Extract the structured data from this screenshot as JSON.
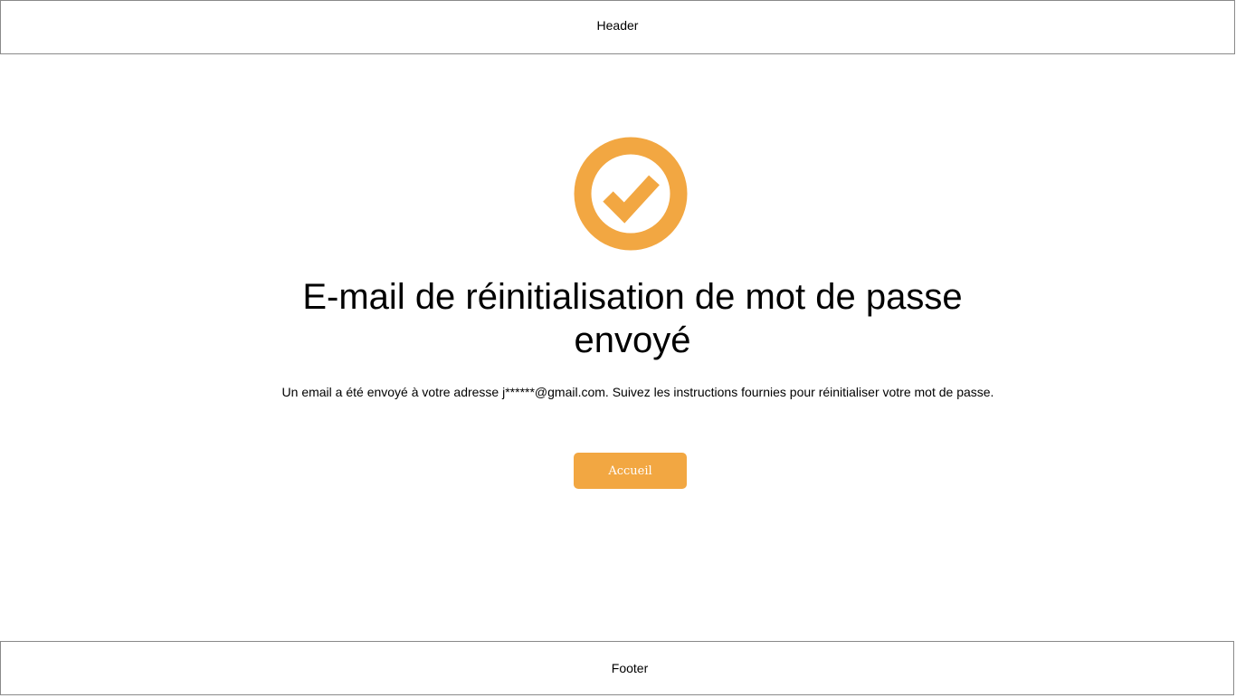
{
  "header": {
    "label": "Header"
  },
  "main": {
    "icon": "check-circle-icon",
    "accent_color": "#f2a742",
    "title": "E-mail de réinitialisation de mot de passe envoyé",
    "message": "Un email a été envoyé à votre adresse j******@gmail.com. Suivez les instructions fournies pour réinitialiser votre mot de passe.",
    "button_label": "Accueil"
  },
  "footer": {
    "label": "Footer"
  }
}
